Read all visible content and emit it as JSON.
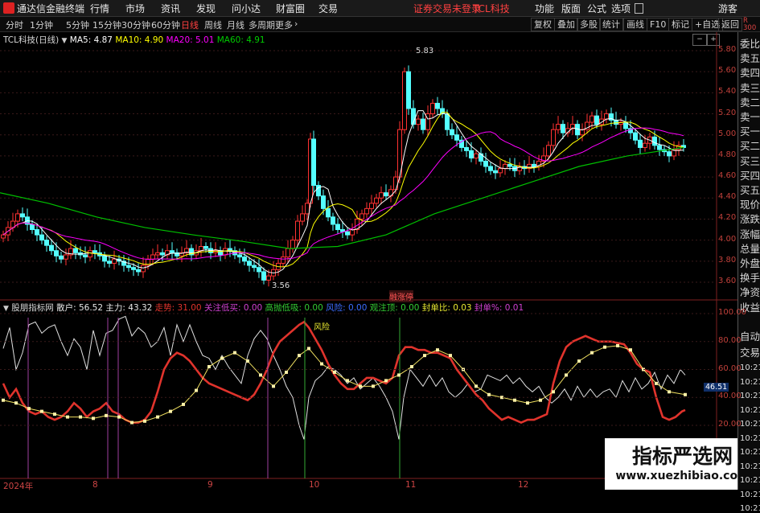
{
  "menubar": {
    "app_title": "通达信金融终端",
    "menus": [
      "行情",
      "市场",
      "资讯",
      "发现",
      "问小达",
      "财富圈",
      "交易"
    ],
    "notice": "证券交易未登录",
    "stock": "TCL科技",
    "right": [
      "功能",
      "版面",
      "公式",
      "选项"
    ],
    "guest": "游客"
  },
  "toolbar": {
    "periods": [
      "分时",
      "1分钟",
      "5分钟",
      "15分钟",
      "30分钟",
      "60分钟",
      "日线",
      "周线",
      "月线",
      "多周期",
      "更多"
    ],
    "active_period": "日线",
    "buttons": [
      "复权",
      "叠加",
      "多股",
      "统计",
      "画线",
      "F10",
      "标记",
      "+自选",
      "返回"
    ]
  },
  "price_legend": {
    "title": "TCL科技(日线)",
    "ma5": "MA5: 4.87",
    "ma10": "MA10: 4.90",
    "ma20": "MA20: 5.01",
    "ma60": "MA60: 4.91"
  },
  "price_axis": [
    "5.80",
    "5.60",
    "5.40",
    "5.20",
    "5.00",
    "4.80",
    "4.60",
    "4.40",
    "4.20",
    "4.00",
    "3.80",
    "3.60"
  ],
  "annotations": {
    "high": "5.83",
    "low": "3.56",
    "badge": "融涨停"
  },
  "indicator_legend": {
    "name": "股朋指标网",
    "items": [
      {
        "text": "散户: 56.52",
        "color": "#e8e8e8"
      },
      {
        "text": "主力: 43.32",
        "color": "#e8e8e8"
      },
      {
        "text": "走势: 31.00",
        "color": "#e0332c"
      },
      {
        "text": "关注低买: 0.00",
        "color": "#d040d0"
      },
      {
        "text": "高抛低吸: 0.00",
        "color": "#33cc33"
      },
      {
        "text": "风险: 0.00",
        "color": "#3b6cff"
      },
      {
        "text": "观注顶: 0.00",
        "color": "#33cc33"
      },
      {
        "text": "封单比: 0.03",
        "color": "#e8e830"
      },
      {
        "text": "封单%: 0.01",
        "color": "#d040d0"
      }
    ],
    "risk_label": "风险"
  },
  "indicator_axis": [
    "100.00",
    "80.00",
    "60.00",
    "40.00",
    "20.00"
  ],
  "indicator_value": "46.51",
  "date_axis": [
    "2024年",
    "8",
    "9",
    "10",
    "11",
    "12"
  ],
  "sidebar": [
    "委比",
    "卖五",
    "卖四",
    "卖三",
    "卖二",
    "卖一",
    "买一",
    "买二",
    "买三",
    "买四",
    "买五",
    "现价",
    "涨跌",
    "涨幅",
    "总量",
    "外盘",
    "换手",
    "净资",
    "收益",
    "自动",
    "交易"
  ],
  "sidebar_top": "R 300",
  "time_col": [
    "10:21",
    "10:21",
    "10:21",
    "10:21",
    "10:21",
    "10:21",
    "10:21",
    "10:21",
    "10:21",
    "10:21",
    "10:21"
  ],
  "watermark": {
    "title": "指标严选网",
    "url": "www.xuezhibiao.com"
  },
  "colors": {
    "up": "#ff3232",
    "down": "#54ffff",
    "ma5": "#ffffff",
    "ma10": "#ffff00",
    "ma20": "#ff00ff",
    "ma60": "#00c000"
  }
}
